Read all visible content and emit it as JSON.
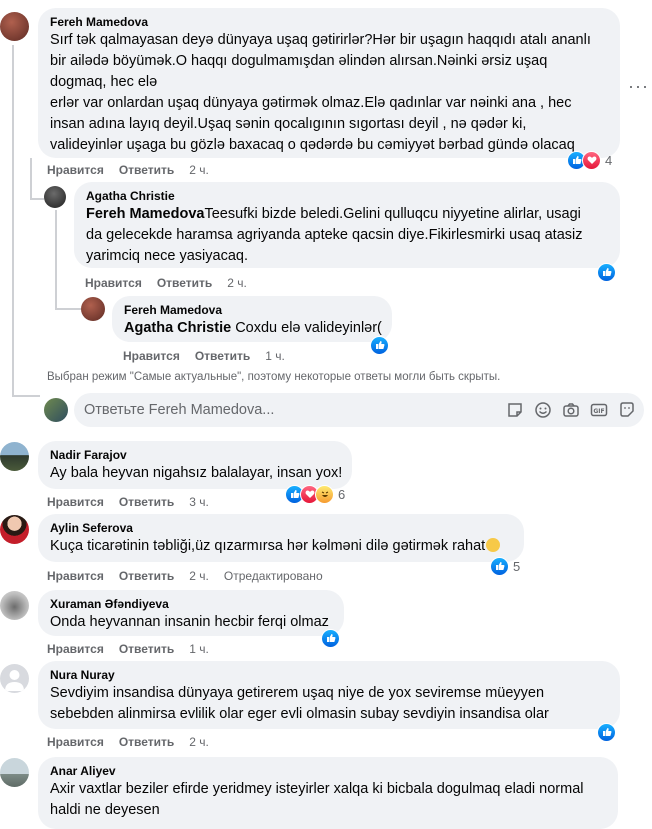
{
  "labels": {
    "like": "Нравится",
    "reply": "Ответить"
  },
  "comments": [
    {
      "author": "Fereh Mamedova",
      "lines": [
        "Sırf tək qalmayasan deyə dünyaya uşaq gətirirlər?Hər bir uşagın haqqıdı atalı ananlı",
        "bir ailədə böyümək.O haqqı dogulmamışdan əlindən alırsan.Nəinki ərsiz uşaq",
        "dogmaq, hec elə",
        "erlər var onlardan uşaq dünyaya gətirmək olmaz.Elə qadınlar var nəinki ana , hec",
        "insan adına layıq deyil.Uşaq sənin qocalıgının sıgortası deyil , nə qədər ki,",
        "valideyinlər uşaga bu gözlə baxacaq o qədərdə bu cəmiyyət bərbad gündə olacaq"
      ],
      "time": "2 ч.",
      "reaction_count": "4"
    },
    {
      "author": "Agatha Christie",
      "mention": "Fereh Mamedova",
      "lines": [
        "Teesufki bizde beledi.Gelini qulluqcu niyyetine alirlar, usagi",
        "da gelecekde haramsa agriyanda apteke qacsin diye.Fikirlesmirki usaq atasiz",
        "yarimciq nece yasiyacaq."
      ],
      "time": "2 ч."
    },
    {
      "author": "Fereh Mamedova",
      "mention": "Agatha Christie",
      "lines": [
        " Coxdu elə valideyinlər("
      ],
      "time": "1 ч."
    },
    {
      "author": "Nadir Farajov",
      "lines": [
        "Ay bala heyvan nigahsız balalayar, insan yox!"
      ],
      "time": "3 ч.",
      "reaction_count": "6"
    },
    {
      "author": "Aylin Seferova",
      "lines": [
        "Kuça ticarətinin təbliği,üz qızarmırsa hər kəlməni dilə gətirmək rahat"
      ],
      "time": "2 ч.",
      "edited": "Отредактировано",
      "reaction_count": "5"
    },
    {
      "author": "Xuraman Əfəndiyeva",
      "lines": [
        "Onda heyvannan insanin hecbir ferqi olmaz"
      ],
      "time": "1 ч."
    },
    {
      "author": "Nura Nuray",
      "lines": [
        "Sevdiyim insandisa dünyaya getirerem uşaq niye de yox seviremse müeyyen",
        "sebebden alinmirsa evlilik olar eger evli olmasin subay sevdiyin insandisa olar"
      ],
      "time": "2 ч."
    },
    {
      "author": "Anar Aliyev",
      "lines": [
        "Axir vaxtlar beziler efirde yeridmey isteyirler xalqa ki bicbala dogulmaq eladi normal",
        "haldi ne deyesen"
      ]
    }
  ],
  "sort_note": "Выбран режим \"Самые актуальные\", поэтому некоторые ответы могли быть скрыты.",
  "reply_placeholder": "Ответьте Fereh Mamedova...",
  "colors": {
    "bubble": "#f0f2f5",
    "like": "#1877f2",
    "love": "#f33e58",
    "meta": "#65676b"
  },
  "icons": [
    "sticker-icon",
    "emoji-icon",
    "camera-icon",
    "gif-icon",
    "sticker-face-icon",
    "more-options-icon",
    "like-reaction-icon",
    "love-reaction-icon",
    "haha-reaction-icon"
  ]
}
